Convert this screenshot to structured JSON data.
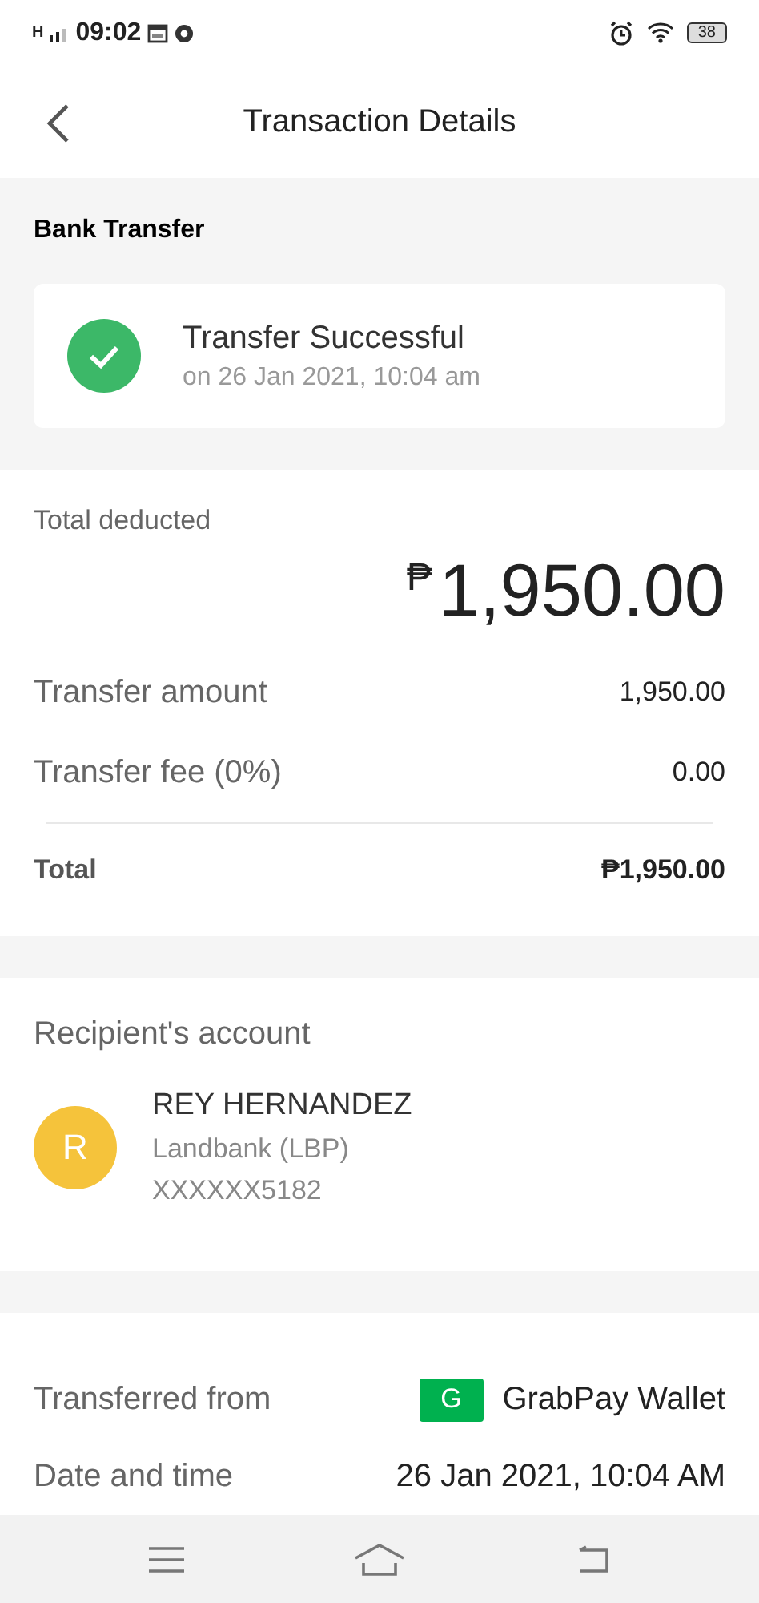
{
  "status_bar": {
    "network": "H",
    "time": "09:02",
    "battery": "38"
  },
  "header": {
    "title": "Transaction Details"
  },
  "status_section": {
    "title": "Bank Transfer",
    "status": "Transfer Successful",
    "timestamp": "on 26 Jan 2021, 10:04 am"
  },
  "amounts": {
    "label": "Total deducted",
    "currency": "₱",
    "total_deducted": "1,950.00",
    "rows": [
      {
        "label": "Transfer amount",
        "value": "1,950.00",
        "kind": "line"
      },
      {
        "label": "Transfer fee (0%)",
        "value": "0.00",
        "kind": "line"
      },
      {
        "label": "Total",
        "value": "₱1,950.00",
        "kind": "total"
      }
    ]
  },
  "recipient": {
    "title": "Recipient's account",
    "initial": "R",
    "name": "REY HERNANDEZ",
    "bank": "Landbank (LBP)",
    "account": "XXXXXX5182"
  },
  "details": [
    {
      "label": "Transferred from",
      "value": "GrabPay Wallet",
      "logo": "G"
    },
    {
      "label": "Date and time",
      "value": "26 Jan 2021, 10:04 AM"
    }
  ]
}
